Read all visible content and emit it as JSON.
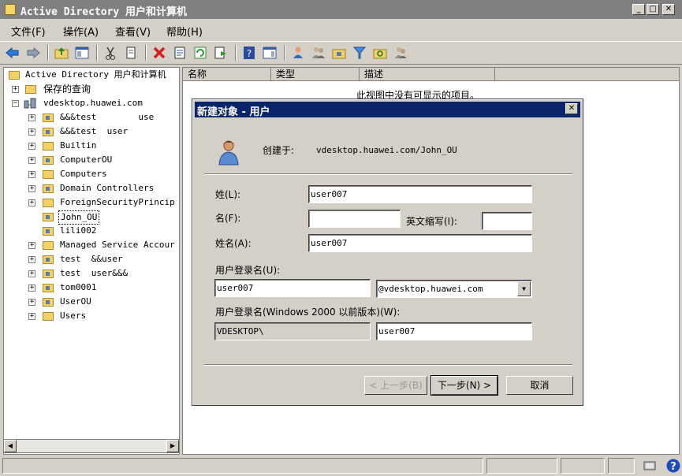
{
  "window": {
    "title": "Active Directory 用户和计算机"
  },
  "menu": [
    "文件(F)",
    "操作(A)",
    "查看(V)",
    "帮助(H)"
  ],
  "tree": {
    "root": "Active Directory 用户和计算机",
    "saved_queries": "保存的查询",
    "domain": "vdesktop.huawei.com",
    "items": [
      "&&&test        use",
      "&&&test  user",
      "Builtin",
      "ComputerOU",
      "Computers",
      "Domain Controllers",
      "ForeignSecurityPrincip",
      "John_OU",
      "lili002",
      "Managed Service Accour",
      "test  &&user",
      "test  user&&&",
      "tom0001",
      "UserOU",
      "Users"
    ]
  },
  "list": {
    "columns": [
      "名称",
      "类型",
      "描述"
    ],
    "empty_text": "此视图中没有可显示的项目。"
  },
  "dialog": {
    "title": "新建对象 - 用户",
    "created_in_label": "创建于:",
    "created_in_value": "vdesktop.huawei.com/John_OU",
    "last_name_label": "姓(L):",
    "last_name_value": "user007",
    "first_name_label": "名(F):",
    "first_name_value": "",
    "initials_label": "英文缩写(I):",
    "initials_value": "",
    "full_name_label": "姓名(A):",
    "full_name_value": "user007",
    "logon_name_label": "用户登录名(U):",
    "logon_name_value": "user007",
    "upn_suffix": "@vdesktop.huawei.com",
    "legacy_logon_label": "用户登录名(Windows 2000 以前版本)(W):",
    "legacy_domain": "VDESKTOP\\",
    "legacy_user": "user007",
    "back_button": "< 上一步(B)",
    "next_button": "下一步(N) >",
    "cancel_button": "取消"
  }
}
